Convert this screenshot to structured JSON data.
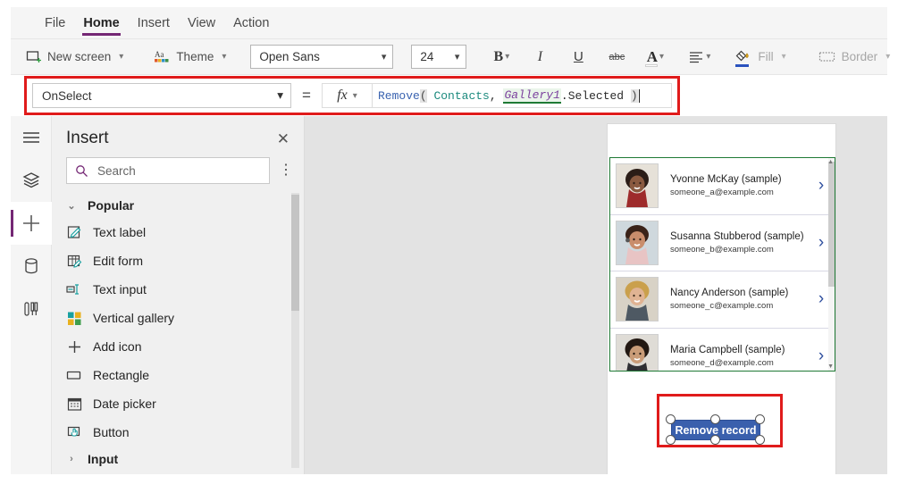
{
  "menubar": {
    "tabs": [
      {
        "label": "File",
        "active": false
      },
      {
        "label": "Home",
        "active": true
      },
      {
        "label": "Insert",
        "active": false
      },
      {
        "label": "View",
        "active": false
      },
      {
        "label": "Action",
        "active": false
      }
    ]
  },
  "ribbon": {
    "new_screen": "New screen",
    "theme": "Theme",
    "font_family": "Open Sans",
    "font_size": "24",
    "bold": "B",
    "italic": "I",
    "underline": "U",
    "strikethrough": "abc",
    "font_color": "A",
    "align": "align-icon",
    "fill": "Fill",
    "border": "Border"
  },
  "formula_bar": {
    "property": "OnSelect",
    "equals": "=",
    "fx": "fx",
    "tokens": [
      {
        "text": "Remove",
        "type": "fn"
      },
      {
        "text": "(",
        "type": "paren"
      },
      {
        "text": " ",
        "type": "plain"
      },
      {
        "text": "Contacts",
        "type": "src"
      },
      {
        "text": ", ",
        "type": "plain"
      },
      {
        "text": "Gallery1",
        "type": "ctrl"
      },
      {
        "text": ".Selected ",
        "type": "plain"
      },
      {
        "text": ")",
        "type": "paren"
      }
    ],
    "formula_text": "Remove( Contacts, Gallery1.Selected )"
  },
  "rail": {
    "items": [
      {
        "name": "hamburger-menu",
        "selected": false
      },
      {
        "name": "tree-view",
        "selected": false
      },
      {
        "name": "insert",
        "selected": true
      },
      {
        "name": "data-sources",
        "selected": false
      },
      {
        "name": "media",
        "selected": false
      }
    ]
  },
  "panel": {
    "title": "Insert",
    "close": "✕",
    "more": "⋮",
    "search_placeholder": "Search",
    "search_value": "",
    "groups": [
      {
        "label": "Popular",
        "expanded": true,
        "chev": "⌄",
        "items": [
          {
            "label": "Text label",
            "icon": "text-label-icon"
          },
          {
            "label": "Edit form",
            "icon": "edit-form-icon"
          },
          {
            "label": "Text input",
            "icon": "text-input-icon"
          },
          {
            "label": "Vertical gallery",
            "icon": "vertical-gallery-icon"
          },
          {
            "label": "Add icon",
            "icon": "add-icon"
          },
          {
            "label": "Rectangle",
            "icon": "rectangle-icon"
          },
          {
            "label": "Date picker",
            "icon": "date-picker-icon"
          },
          {
            "label": "Button",
            "icon": "button-icon"
          }
        ]
      },
      {
        "label": "Input",
        "expanded": false,
        "chev": "›",
        "items": []
      }
    ]
  },
  "canvas": {
    "gallery": {
      "border_color": "#1f7a35",
      "rows": [
        {
          "name": "Yvonne McKay (sample)",
          "email": "someone_a@example.com",
          "chevron": "›"
        },
        {
          "name": "Susanna Stubberod (sample)",
          "email": "someone_b@example.com",
          "chevron": "›"
        },
        {
          "name": "Nancy Anderson (sample)",
          "email": "someone_c@example.com",
          "chevron": "›"
        },
        {
          "name": "Maria Campbell (sample)",
          "email": "someone_d@example.com",
          "chevron": "›"
        }
      ]
    },
    "button": {
      "label": "Remove record",
      "fill": "#3a60ad",
      "text_color": "#ffffff",
      "selected": true
    }
  },
  "highlights": {
    "color": "#e01b1b",
    "boxes": [
      "formula-bar",
      "remove-record-button"
    ]
  }
}
